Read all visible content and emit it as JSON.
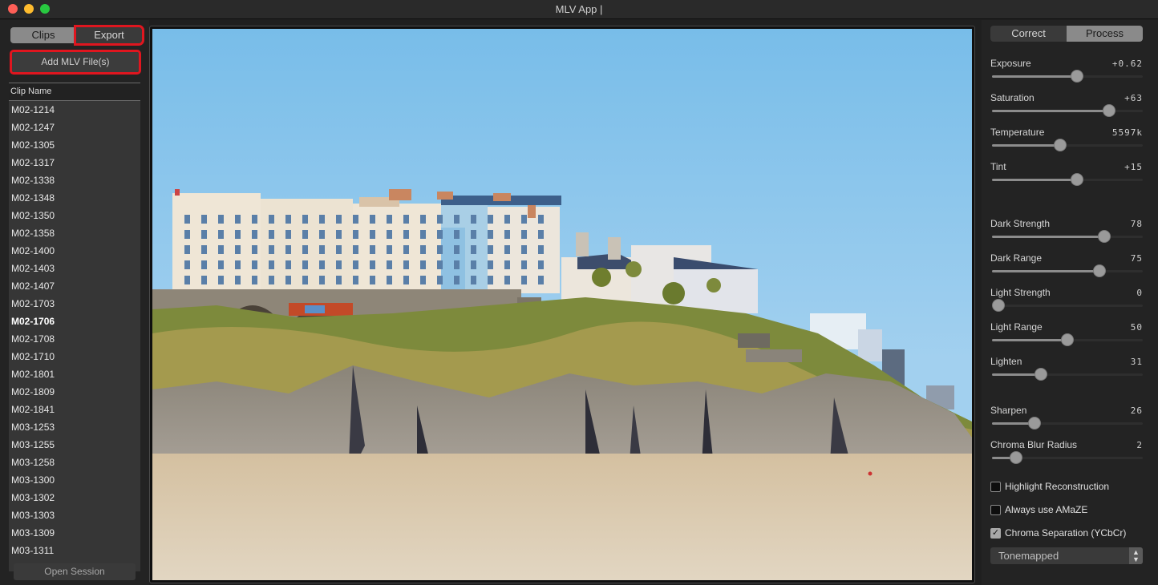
{
  "window": {
    "title": "MLV App |",
    "controls": [
      "close",
      "minimize",
      "maximize"
    ]
  },
  "left_panel": {
    "tabs": [
      {
        "label": "Clips",
        "selected": true
      },
      {
        "label": "Export",
        "selected": false,
        "highlighted": true
      }
    ],
    "add_button_label": "Add MLV File(s)",
    "list_header": "Clip Name",
    "clips": [
      {
        "name": "M02-1214",
        "active": false
      },
      {
        "name": "M02-1247",
        "active": false
      },
      {
        "name": "M02-1305",
        "active": false
      },
      {
        "name": "M02-1317",
        "active": false
      },
      {
        "name": "M02-1338",
        "active": false
      },
      {
        "name": "M02-1348",
        "active": false
      },
      {
        "name": "M02-1350",
        "active": false
      },
      {
        "name": "M02-1358",
        "active": false
      },
      {
        "name": "M02-1400",
        "active": false
      },
      {
        "name": "M02-1403",
        "active": false
      },
      {
        "name": "M02-1407",
        "active": false
      },
      {
        "name": "M02-1703",
        "active": false
      },
      {
        "name": "M02-1706",
        "active": true
      },
      {
        "name": "M02-1708",
        "active": false
      },
      {
        "name": "M02-1710",
        "active": false
      },
      {
        "name": "M02-1801",
        "active": false
      },
      {
        "name": "M02-1809",
        "active": false
      },
      {
        "name": "M02-1841",
        "active": false
      },
      {
        "name": "M03-1253",
        "active": false
      },
      {
        "name": "M03-1255",
        "active": false
      },
      {
        "name": "M03-1258",
        "active": false
      },
      {
        "name": "M03-1300",
        "active": false
      },
      {
        "name": "M03-1302",
        "active": false
      },
      {
        "name": "M03-1303",
        "active": false
      },
      {
        "name": "M03-1309",
        "active": false
      },
      {
        "name": "M03-1311",
        "active": false
      }
    ],
    "open_session_label": "Open Session"
  },
  "preview": {
    "description": "Seaside cliff with terraced hotels above a sandy beach under blue sky"
  },
  "right_panel": {
    "tabs": [
      {
        "label": "Correct",
        "selected": false
      },
      {
        "label": "Process",
        "selected": true
      }
    ],
    "sliders": [
      {
        "label": "Exposure",
        "value": "+0.62",
        "fraction": 0.57
      },
      {
        "label": "Saturation",
        "value": "+63",
        "fraction": 0.8
      },
      {
        "label": "Temperature",
        "value": "5597k",
        "fraction": 0.45
      },
      {
        "label": "Tint",
        "value": "+15",
        "fraction": 0.57
      },
      {
        "label": "Dark Strength",
        "value": "78",
        "fraction": 0.77
      },
      {
        "label": "Dark Range",
        "value": "75",
        "fraction": 0.73
      },
      {
        "label": "Light Strength",
        "value": "0",
        "fraction": 0.0
      },
      {
        "label": "Light Range",
        "value": "50",
        "fraction": 0.5
      },
      {
        "label": "Lighten",
        "value": "31",
        "fraction": 0.31
      },
      {
        "label": "Sharpen",
        "value": "26",
        "fraction": 0.26
      },
      {
        "label": "Chroma Blur Radius",
        "value": "2",
        "fraction": 0.13
      }
    ],
    "checkboxes": [
      {
        "label": "Highlight Reconstruction",
        "checked": false
      },
      {
        "label": "Always use AMaZE",
        "checked": false
      },
      {
        "label": "Chroma Separation (YCbCr)",
        "checked": true
      }
    ],
    "tonemap_select": {
      "value": "Tonemapped"
    }
  },
  "colors": {
    "highlight_outline": "#e0161f",
    "panel_bg": "#232323",
    "list_bg": "#363636",
    "selected_segment": "#8a8a8a"
  }
}
